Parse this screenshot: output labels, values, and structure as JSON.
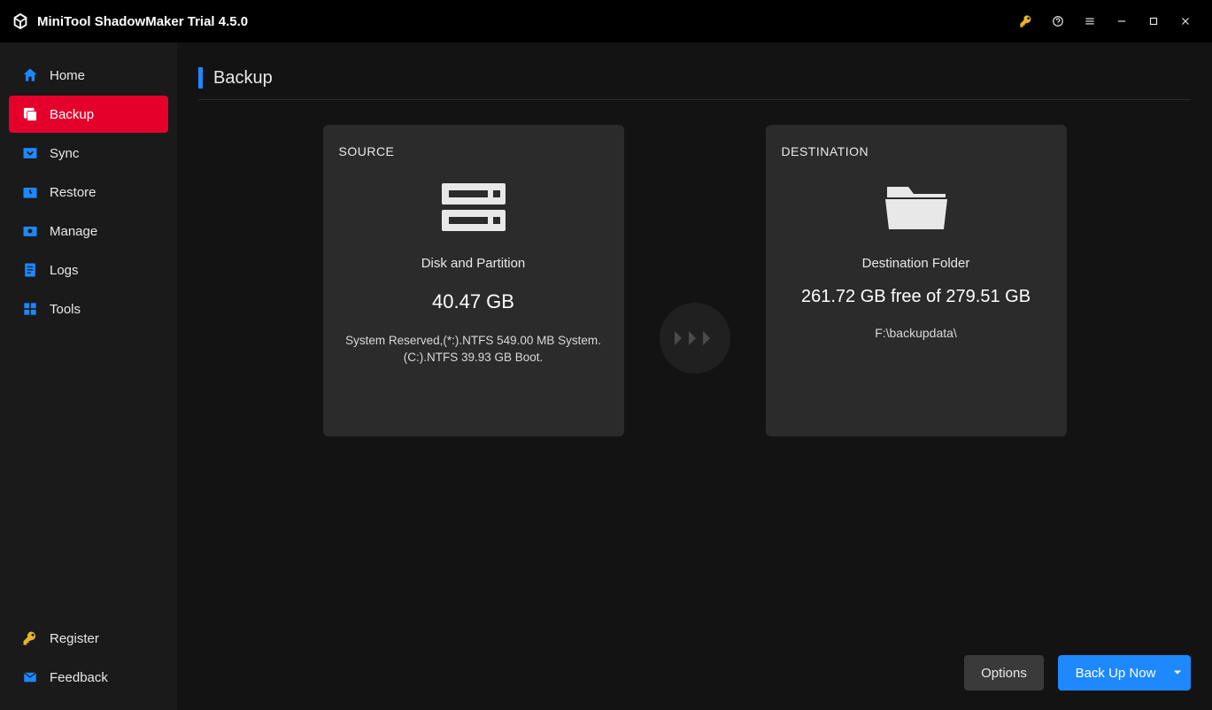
{
  "app": {
    "title": "MiniTool ShadowMaker Trial 4.5.0"
  },
  "sidebar": {
    "items": [
      {
        "label": "Home"
      },
      {
        "label": "Backup"
      },
      {
        "label": "Sync"
      },
      {
        "label": "Restore"
      },
      {
        "label": "Manage"
      },
      {
        "label": "Logs"
      },
      {
        "label": "Tools"
      }
    ],
    "bottom": {
      "register": "Register",
      "feedback": "Feedback"
    }
  },
  "page": {
    "title": "Backup"
  },
  "source": {
    "heading": "SOURCE",
    "type": "Disk and Partition",
    "size": "40.47 GB",
    "detail": "System Reserved,(*:).NTFS 549.00 MB System.(C:).NTFS 39.93 GB Boot."
  },
  "destination": {
    "heading": "DESTINATION",
    "type": "Destination Folder",
    "space": "261.72 GB free of 279.51 GB",
    "path": "F:\\backupdata\\"
  },
  "footer": {
    "options": "Options",
    "backup_now": "Back Up Now"
  }
}
